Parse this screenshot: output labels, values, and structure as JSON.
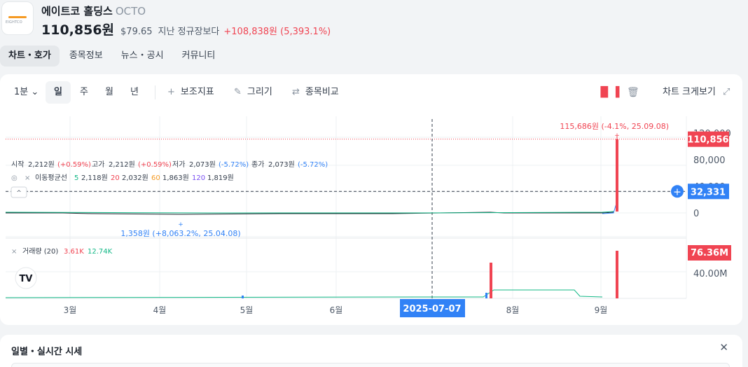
{
  "stock": {
    "name": "에이트코 홀딩스",
    "code": "OCTO",
    "logo_text": "EIGHTCO",
    "price_krw": "110,856원",
    "price_usd": "$79.65",
    "compare_label": "지난 정규장보다",
    "change": "+108,838원 (5,393.1%)"
  },
  "tabs": [
    {
      "label": "차트・호가",
      "active": true
    },
    {
      "label": "종목정보",
      "active": false
    },
    {
      "label": "뉴스・공시",
      "active": false
    },
    {
      "label": "커뮤니티",
      "active": false
    }
  ],
  "toolbar": {
    "interval": "1분",
    "periods": [
      "일",
      "주",
      "월",
      "년"
    ],
    "active_period": "일",
    "indicators": "보조지표",
    "draw": "그리기",
    "compare": "종목비교",
    "expand": "차트 크게보기"
  },
  "chart_data": {
    "type": "candlestick",
    "ohlc_legend": {
      "open_label": "시작",
      "open": "2,212원",
      "open_pct": "(+0.59%)",
      "high_label": "고가",
      "high": "2,212원",
      "high_pct": "(+0.59%)",
      "low_label": "저가",
      "low": "2,073원",
      "low_pct": "(-5.72%)",
      "close_label": "종가",
      "close": "2,073원",
      "close_pct": "(-5.72%)"
    },
    "ma_legend": {
      "label": "이동평균선",
      "ma5_label": "5",
      "ma5": "2,118원",
      "ma20_label": "20",
      "ma20": "2,032원",
      "ma60_label": "60",
      "ma60": "1,863원",
      "ma120_label": "120",
      "ma120": "1,819원"
    },
    "max_annotation": "115,686원 (-4.1%, 25.09.08)",
    "min_annotation": "1,358원 (+8,063.2%, 25.04.08)",
    "y_ticks": [
      {
        "value": 120000,
        "label": "120,000"
      },
      {
        "value": 80000,
        "label": "80,000"
      },
      {
        "value": 40000,
        "label": "40,000"
      },
      {
        "value": 0,
        "label": "0"
      }
    ],
    "y_range": [
      0,
      120000
    ],
    "current_price": 110856,
    "current_price_label": "110,856",
    "crosshair_price": 32331,
    "crosshair_label": "32,331",
    "crosshair_date": "2025-07-07",
    "x_labels": [
      "3월",
      "4월",
      "5월",
      "6월",
      "7월",
      "8월",
      "9월"
    ],
    "volume_legend": {
      "label": "거래량 (20)",
      "v1": "3.61K",
      "v2": "12.74K"
    },
    "volume_current_label": "76.36M",
    "volume_tick_label": "40.00M",
    "volume_max": 76.36,
    "volume_spikes_m": [
      {
        "date": "2025-07-24",
        "value": 48
      },
      {
        "date": "2025-09-08",
        "value": 76.36
      }
    ],
    "last_candle": {
      "open": 2073,
      "high": 115686,
      "low": 2073,
      "close": 110856,
      "date": "2025-09-08"
    }
  },
  "daily": {
    "title": "일별・실시간 시세"
  },
  "colors": {
    "up": "#f04452",
    "down": "#3182f6",
    "ma": "#12b886",
    "accent": "#3182f6"
  }
}
